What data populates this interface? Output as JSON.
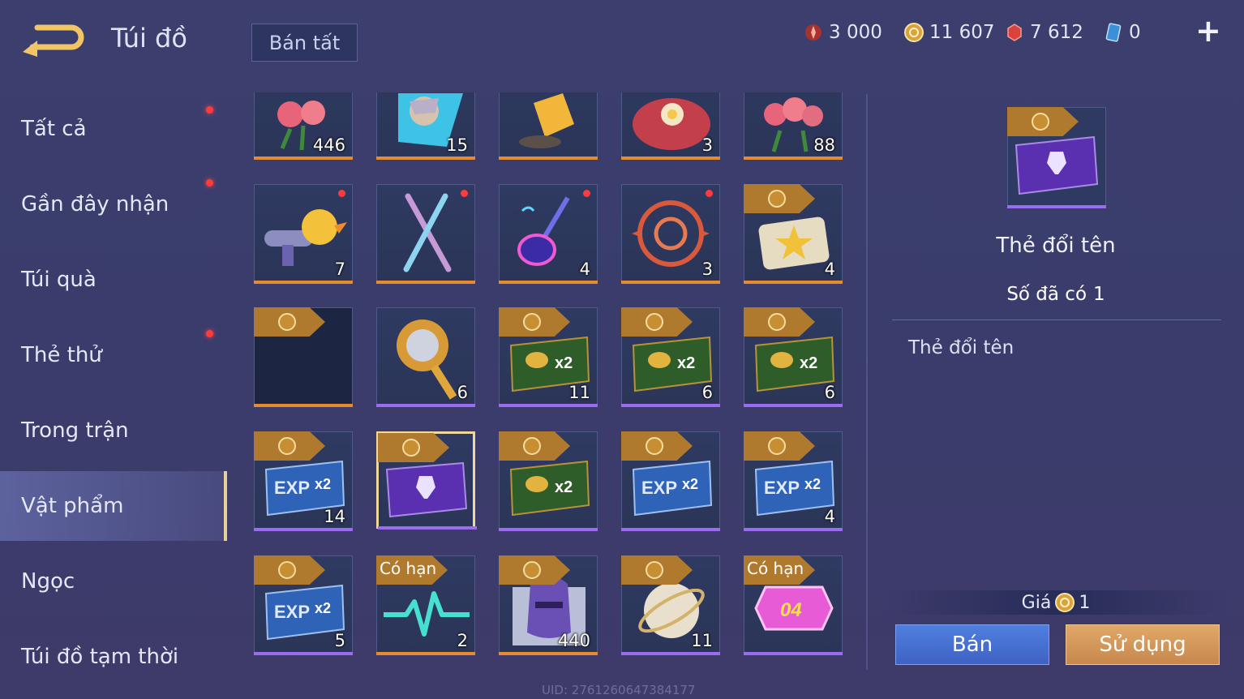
{
  "header": {
    "title": "Túi đồ",
    "sell_all_label": "Bán tất",
    "currencies": [
      {
        "icon": "red-voucher-icon",
        "value": "3 000"
      },
      {
        "icon": "gold-coin-icon",
        "value": "11 607"
      },
      {
        "icon": "red-gem-icon",
        "value": "7 612"
      },
      {
        "icon": "blue-card-icon",
        "value": "0"
      }
    ],
    "plus_label": "+"
  },
  "sidebar": {
    "items": [
      {
        "label": "Tất cả",
        "dot": true
      },
      {
        "label": "Gần đây nhận",
        "dot": true
      },
      {
        "label": "Túi quà",
        "dot": false
      },
      {
        "label": "Thẻ thử",
        "dot": true
      },
      {
        "label": "Trong trận",
        "dot": false
      },
      {
        "label": "Vật phẩm",
        "dot": false,
        "active": true
      },
      {
        "label": "Ngọc",
        "dot": false
      },
      {
        "label": "Túi đồ tạm thời",
        "dot": false
      }
    ]
  },
  "grid": {
    "rows": [
      [
        {
          "icon": "rose-bouquet-icon",
          "count": "446",
          "bar": "orange"
        },
        {
          "icon": "hero-card-icon",
          "count": "15",
          "bar": "orange"
        },
        {
          "icon": "golden-tube-icon",
          "count": "",
          "bar": "orange"
        },
        {
          "icon": "gift-box-icon",
          "count": "3",
          "bar": "orange"
        },
        {
          "icon": "rose-bouquet-icon",
          "count": "88",
          "bar": "orange"
        }
      ],
      [
        {
          "icon": "duck-blaster-icon",
          "count": "7",
          "bar": "orange",
          "dot": true
        },
        {
          "icon": "light-sabers-icon",
          "count": "",
          "bar": "orange",
          "dot": true
        },
        {
          "icon": "neon-guitar-icon",
          "count": "4",
          "bar": "orange",
          "dot": true
        },
        {
          "icon": "dragon-emblem-icon",
          "count": "3",
          "bar": "orange",
          "dot": true
        },
        {
          "icon": "star-ticket-icon",
          "count": "4",
          "bar": "orange",
          "tag": "coin"
        }
      ],
      [
        {
          "icon": "empty-dark-icon",
          "count": "",
          "bar": "orange",
          "tag": "coin"
        },
        {
          "icon": "golden-scepter-icon",
          "count": "6",
          "bar": "purple"
        },
        {
          "icon": "gold-x2-card-icon",
          "count": "11",
          "bar": "purple",
          "tag": "coin"
        },
        {
          "icon": "gold-x2-card-icon",
          "count": "6",
          "bar": "purple",
          "tag": "coin"
        },
        {
          "icon": "gold-x2-card-icon",
          "count": "6",
          "bar": "purple",
          "tag": "coin"
        }
      ],
      [
        {
          "icon": "exp-x2-card-icon",
          "count": "14",
          "bar": "purple",
          "tag": "coin"
        },
        {
          "icon": "rename-card-icon",
          "count": "",
          "bar": "purple",
          "tag": "coin",
          "selected": true
        },
        {
          "icon": "gold-x2-card-icon",
          "count": "",
          "bar": "purple",
          "tag": "coin"
        },
        {
          "icon": "exp-x2-card-icon",
          "count": "",
          "bar": "purple",
          "tag": "coin"
        },
        {
          "icon": "exp-x2-card-icon",
          "count": "4",
          "bar": "purple",
          "tag": "coin"
        }
      ],
      [
        {
          "icon": "exp-x2-card-icon",
          "count": "5",
          "bar": "purple",
          "tag": "coin"
        },
        {
          "icon": "heartbeat-wave-icon",
          "count": "2",
          "bar": "orange",
          "tag_text": "Có hạn"
        },
        {
          "icon": "knight-helmet-icon",
          "count": "440",
          "bar": "orange",
          "tag": "coin"
        },
        {
          "icon": "celestial-orb-icon",
          "count": "11",
          "bar": "purple",
          "tag": "coin"
        },
        {
          "icon": "hex-04-badge-icon",
          "count": "",
          "bar": "purple",
          "tag_text": "Có hạn"
        }
      ]
    ]
  },
  "detail": {
    "name": "Thẻ đổi tên",
    "owned_label": "Số đã có",
    "owned_value": "1",
    "description": "Thẻ đổi tên",
    "price_label": "Giá",
    "price_value": "1",
    "sell_label": "Bán",
    "use_label": "Sử dụng"
  },
  "uid": "UID: 2761260647384177",
  "colors": {
    "bar_orange": "#e88a2e",
    "bar_purple": "#9b6cf0",
    "tag": "#b07a2e",
    "selected_border": "#f0d89a"
  }
}
